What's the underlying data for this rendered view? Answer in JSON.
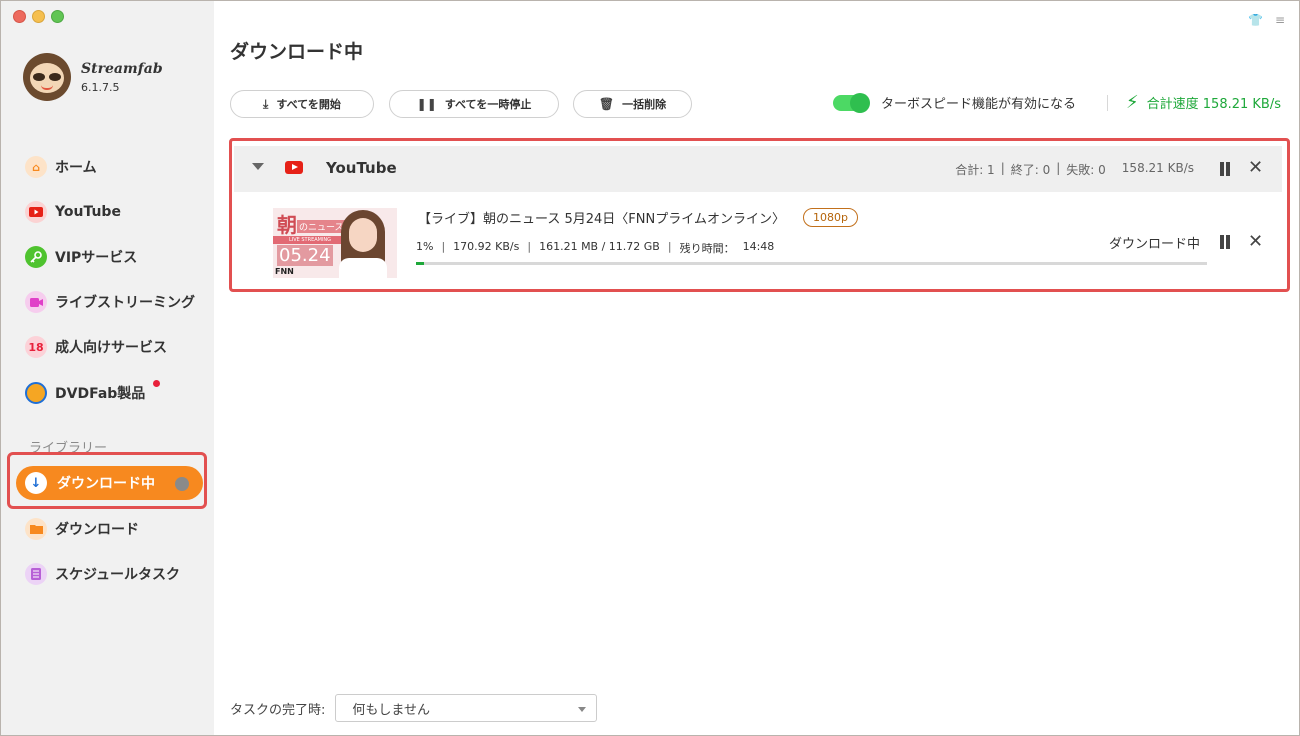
{
  "app": {
    "name": "Streamfab",
    "version": "6.1.7.5"
  },
  "sidebar": {
    "items": [
      {
        "label": "ホーム",
        "icon": "home-icon",
        "color": "#f7891f"
      },
      {
        "label": "YouTube",
        "icon": "youtube-icon",
        "color": "#e62117"
      },
      {
        "label": "VIPサービス",
        "icon": "key-icon",
        "color": "#4fc32f"
      },
      {
        "label": "ライブストリーミング",
        "icon": "video-camera-icon",
        "color": "#e040c8"
      },
      {
        "label": "成人向けサービス",
        "icon": "adult-18-icon",
        "color": "#e8213b"
      },
      {
        "label": "DVDFab製品",
        "icon": "dvdfab-icon",
        "color": "#f5a623"
      }
    ],
    "library_title": "ライブラリー",
    "library": [
      {
        "label": "ダウンロード中",
        "icon": "download-arrow-icon",
        "active": true
      },
      {
        "label": "ダウンロード",
        "icon": "folder-icon",
        "color": "#f7891f"
      },
      {
        "label": "スケジュールタスク",
        "icon": "schedule-icon",
        "color": "#b760d6"
      }
    ]
  },
  "main": {
    "title": "ダウンロード中",
    "toolbar": {
      "start_all": "すべてを開始",
      "pause_all": "すべてを一時停止",
      "delete_all": "一括削除"
    },
    "turbo_label": "ターボスピード機能が有効になる",
    "total_speed": "合計速度 158.21 KB/s",
    "group": {
      "name": "YouTube",
      "total": "合計: 1",
      "done": "終了: 0",
      "failed": "失敗: 0",
      "speed": "158.21 KB/s"
    },
    "item": {
      "title": "【ライブ】朝のニュース 5月24日〈FNNプライムオンライン〉",
      "resolution": "1080p",
      "percent": "1%",
      "speed": "170.92 KB/s",
      "size": "161.21 MB / 11.72 GB",
      "remaining_label": "残り時間：",
      "remaining": "14:48",
      "status": "ダウンロード中",
      "progress": 0.01,
      "thumbnail": {
        "kanji": "朝",
        "sub": "のニュース",
        "bar": "LIVE STREAMING",
        "date": "05.24",
        "brand": "FNN"
      }
    },
    "footer": {
      "label": "タスクの完了時:",
      "select_value": "何もしません"
    }
  }
}
